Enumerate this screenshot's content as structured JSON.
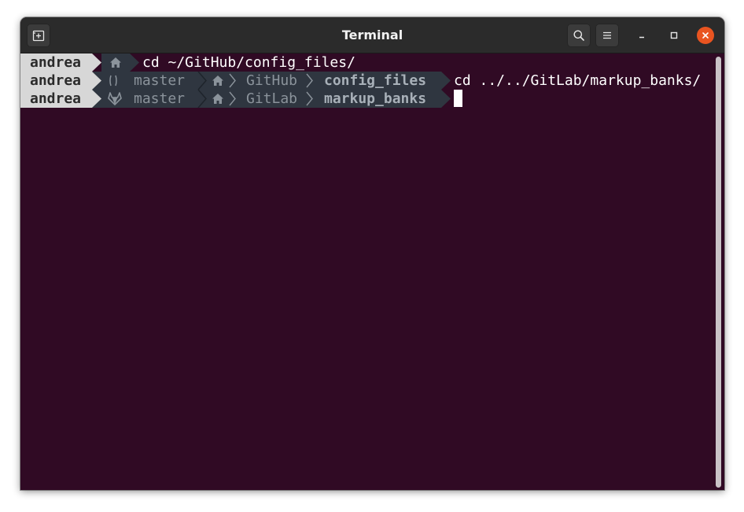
{
  "window": {
    "title": "Terminal"
  },
  "colors": {
    "terminal_background": "#300a24",
    "titlebar": "#2b2b2b",
    "user_segment": "#d7d7d7",
    "path_segment": "#2f3640",
    "close_button": "#e95420"
  },
  "titlebar_buttons": {
    "new_tab_icon": "new-tab-icon",
    "search_icon": "search-icon",
    "menu_icon": "hamburger-menu-icon",
    "minimize_icon": "minimize-icon",
    "maximize_icon": "maximize-icon",
    "close_icon": "close-icon"
  },
  "terminal": {
    "lines": [
      {
        "user": "andrea",
        "path": [
          "~"
        ],
        "command": "cd ~/GitHub/config_files/"
      },
      {
        "user": "andrea",
        "vcs_icon": "git-branch-icon",
        "branch": "master",
        "path_dim": "GitHub",
        "path_current": "config_files",
        "command": "cd ../../GitLab/markup_banks/"
      },
      {
        "user": "andrea",
        "vcs_icon": "gitlab-icon",
        "branch": "master",
        "path_dim": "GitLab",
        "path_current": "markup_banks",
        "command": ""
      }
    ]
  }
}
